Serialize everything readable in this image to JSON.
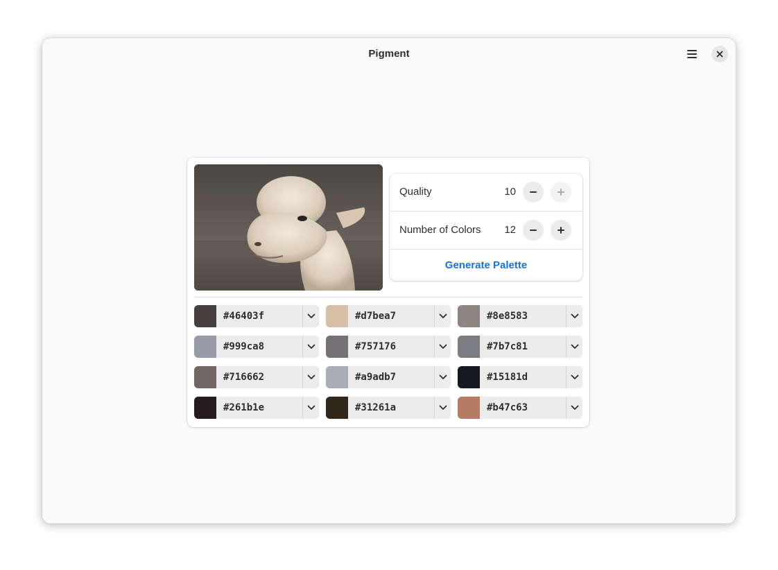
{
  "window": {
    "title": "Pigment"
  },
  "icons": {
    "menu": "hamburger-menu-icon",
    "close": "close-icon",
    "minus": "minus-icon",
    "plus": "plus-icon",
    "dropdown": "chevron-down-icon"
  },
  "image": {
    "subject": "alpaca-photo"
  },
  "settings": {
    "quality": {
      "label": "Quality",
      "value": "10",
      "plus_disabled": true
    },
    "num_colors": {
      "label": "Number of Colors",
      "value": "12"
    },
    "generate_label": "Generate Palette"
  },
  "accent_color": "#1c71d8",
  "palette": [
    {
      "hex": "#46403f",
      "label": "#46403f"
    },
    {
      "hex": "#d7bea7",
      "label": "#d7bea7"
    },
    {
      "hex": "#8e8583",
      "label": "#8e8583"
    },
    {
      "hex": "#999ca8",
      "label": "#999ca8"
    },
    {
      "hex": "#757176",
      "label": "#757176"
    },
    {
      "hex": "#7b7c81",
      "label": "#7b7c81"
    },
    {
      "hex": "#716662",
      "label": "#716662"
    },
    {
      "hex": "#a9adb7",
      "label": "#a9adb7"
    },
    {
      "hex": "#15181d",
      "label": "#15181d"
    },
    {
      "hex": "#261b1e",
      "label": "#261b1e"
    },
    {
      "hex": "#31261a",
      "label": "#31261a"
    },
    {
      "hex": "#b47c63",
      "label": "#b47c63"
    }
  ]
}
